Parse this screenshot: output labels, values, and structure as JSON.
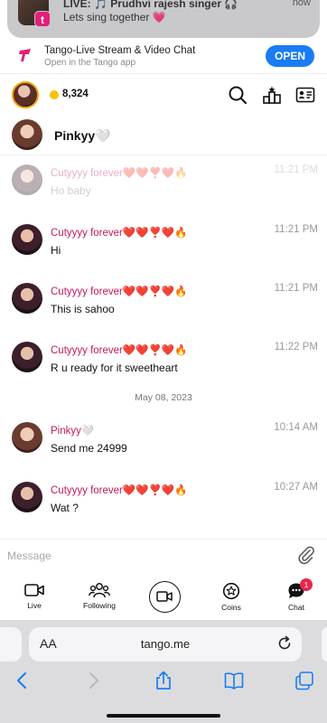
{
  "notification": {
    "title": "LIVE: 🎵 Prudhvi rajesh singer 🎧",
    "body": "Lets sing together 💗",
    "time": "now"
  },
  "app_banner": {
    "name": "Tango-Live Stream & Video Chat",
    "subtitle": "Open in the Tango app",
    "open_label": "OPEN"
  },
  "topbar": {
    "coins": "8,324",
    "icons": [
      "search-icon",
      "leaderboard-icon",
      "profile-card-icon"
    ]
  },
  "chat": {
    "name": "Pinkyy🤍"
  },
  "messages": [
    {
      "sender": "Cutyyyy forever❤️❤️❣️❤️🔥",
      "text": "Ho baby",
      "time": "11:21 PM"
    },
    {
      "sender": "Cutyyyy forever❤️❤️❣️❤️🔥",
      "text": "Hi",
      "time": "11:21 PM"
    },
    {
      "sender": "Cutyyyy forever❤️❤️❣️❤️🔥",
      "text": "This is sahoo",
      "time": "11:21 PM"
    },
    {
      "sender": "Cutyyyy forever❤️❤️❣️❤️🔥",
      "text": "R u ready for it sweetheart",
      "time": "11:22 PM"
    },
    {
      "sender": "Pinkyy🤍",
      "text": "Send me 24999",
      "time": "10:14 AM"
    },
    {
      "sender": "Cutyyyy forever❤️❤️❣️❤️🔥",
      "text": "Wat ?",
      "time": "10:27 AM"
    }
  ],
  "date_separator": "May 08, 2023",
  "composer": {
    "placeholder": "Message"
  },
  "nav": {
    "live": "Live",
    "following": "Following",
    "coins": "Coins",
    "chat": "Chat",
    "chat_badge": "1"
  },
  "browser": {
    "aa": "AA",
    "url": "tango.me"
  },
  "colors": {
    "accent": "#1a7cf2",
    "brand": "#e31f77",
    "sender": "#c2185b",
    "badge": "#e8264f"
  }
}
